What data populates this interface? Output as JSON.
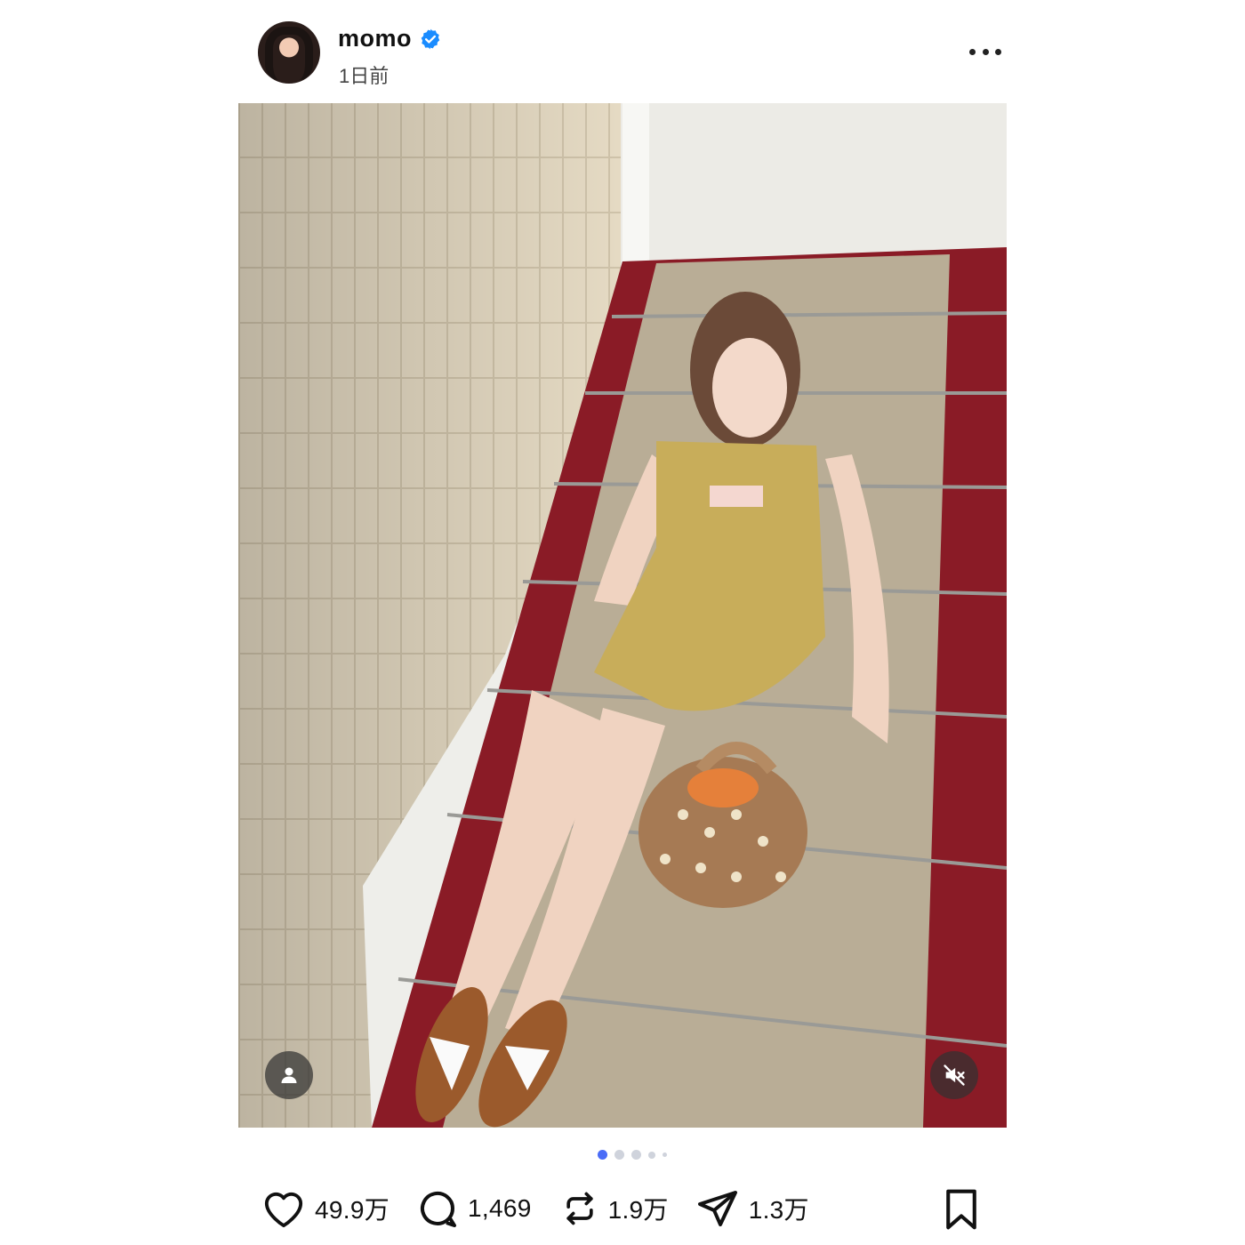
{
  "post": {
    "username": "momo",
    "timestamp": "1日前",
    "verified": true
  },
  "icons": {
    "more": "more-horizontal-icon",
    "verified": "verified-badge-icon",
    "tag": "user-tag-icon",
    "mute": "volume-muted-icon",
    "like": "heart-icon",
    "comment": "comment-bubble-icon",
    "repost": "repost-icon",
    "share": "send-icon",
    "save": "bookmark-icon"
  },
  "carousel": {
    "total": 5,
    "active_index": 0
  },
  "actions": {
    "likes": "49.9万",
    "comments": "1,469",
    "reposts": "1.9万",
    "shares": "1.3万"
  },
  "colors": {
    "accent": "#4a6cf7",
    "verified": "#1a8cff",
    "text": "#111111"
  }
}
